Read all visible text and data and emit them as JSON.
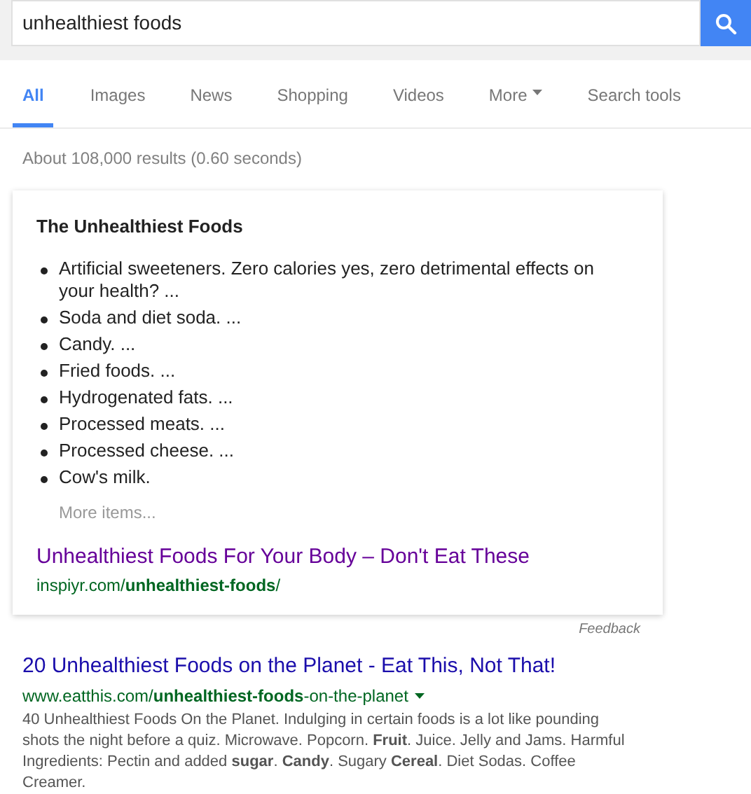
{
  "search": {
    "value": "unhealthiest foods"
  },
  "tabs": [
    {
      "label": "All",
      "selected": true,
      "dropdown": false
    },
    {
      "label": "Images",
      "selected": false,
      "dropdown": false
    },
    {
      "label": "News",
      "selected": false,
      "dropdown": false
    },
    {
      "label": "Shopping",
      "selected": false,
      "dropdown": false
    },
    {
      "label": "Videos",
      "selected": false,
      "dropdown": false
    },
    {
      "label": "More",
      "selected": false,
      "dropdown": true
    },
    {
      "label": "Search tools",
      "selected": false,
      "dropdown": false
    }
  ],
  "result_stats": "About 108,000 results (0.60 seconds)",
  "featured_snippet": {
    "title": "The Unhealthiest Foods",
    "items": [
      "Artificial sweeteners. Zero calories yes, zero detrimental effects on your health? ...",
      "Soda and diet soda. ...",
      "Candy. ...",
      "Fried foods. ...",
      "Hydrogenated fats. ...",
      "Processed meats. ...",
      "Processed cheese. ...",
      "Cow's milk."
    ],
    "more_items": "More items...",
    "link_title": "Unhealthiest Foods For Your Body – Don't Eat These",
    "visited": true,
    "url": "inspiyr.com/**unhealthiest-foods**/"
  },
  "feedback": "Feedback",
  "results": [
    {
      "title": "20 Unhealthiest Foods on the Planet - Eat This, Not That!",
      "url": "www.eatthis.com/**unhealthiest-foods**-on-the-planet",
      "snippet": "40 Unhealthiest Foods On the Planet. Indulging in certain foods is a lot like pounding shots the night before a quiz. Microwave. Popcorn. **Fruit**. Juice. Jelly and Jams. Harmful Ingredients: Pectin and added **sugar**. **Candy**. Sugary **Cereal**. Diet Sodas. Coffee Creamer."
    }
  ]
}
